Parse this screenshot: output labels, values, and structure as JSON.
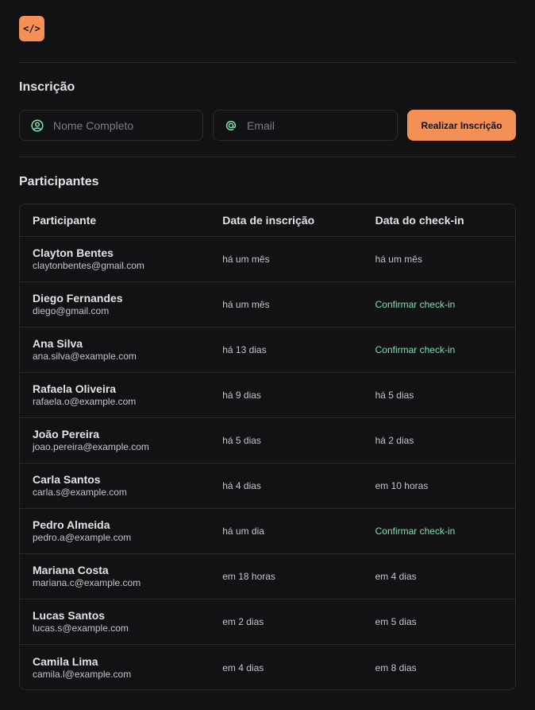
{
  "logo": {
    "icon": "code-icon",
    "color": "#f48f56",
    "glyph": "</>"
  },
  "signup": {
    "title": "Inscrição",
    "name_placeholder": "Nome Completo",
    "email_placeholder": "Email",
    "submit_label": "Realizar Inscrição"
  },
  "participants": {
    "title": "Participantes",
    "columns": [
      "Participante",
      "Data de inscrição",
      "Data do check-in"
    ],
    "rows": [
      {
        "name": "Clayton Bentes",
        "email": "claytonbentes@gmail.com",
        "registered": "há um mês",
        "checkin": "há um mês",
        "checkin_pending": false
      },
      {
        "name": "Diego Fernandes",
        "email": "diego@gmail.com",
        "registered": "há um mês",
        "checkin": "Confirmar check-in",
        "checkin_pending": true
      },
      {
        "name": "Ana Silva",
        "email": "ana.silva@example.com",
        "registered": "há 13 dias",
        "checkin": "Confirmar check-in",
        "checkin_pending": true
      },
      {
        "name": "Rafaela Oliveira",
        "email": "rafaela.o@example.com",
        "registered": "há 9 dias",
        "checkin": "há 5 dias",
        "checkin_pending": false
      },
      {
        "name": "João Pereira",
        "email": "joao.pereira@example.com",
        "registered": "há 5 dias",
        "checkin": "há 2 dias",
        "checkin_pending": false
      },
      {
        "name": "Carla Santos",
        "email": "carla.s@example.com",
        "registered": "há 4 dias",
        "checkin": "em 10 horas",
        "checkin_pending": false
      },
      {
        "name": "Pedro Almeida",
        "email": "pedro.a@example.com",
        "registered": "há um dia",
        "checkin": "Confirmar check-in",
        "checkin_pending": true
      },
      {
        "name": "Mariana Costa",
        "email": "mariana.c@example.com",
        "registered": "em 18 horas",
        "checkin": "em 4 dias",
        "checkin_pending": false
      },
      {
        "name": "Lucas Santos",
        "email": "lucas.s@example.com",
        "registered": "em 2 dias",
        "checkin": "em 5 dias",
        "checkin_pending": false
      },
      {
        "name": "Camila Lima",
        "email": "camila.l@example.com",
        "registered": "em 4 dias",
        "checkin": "em 8 dias",
        "checkin_pending": false
      }
    ]
  },
  "colors": {
    "background": "#121214",
    "accent": "#f48f56",
    "border": "#29292e",
    "confirm": "#7ee2a8",
    "icon": "#7ee2a8"
  }
}
